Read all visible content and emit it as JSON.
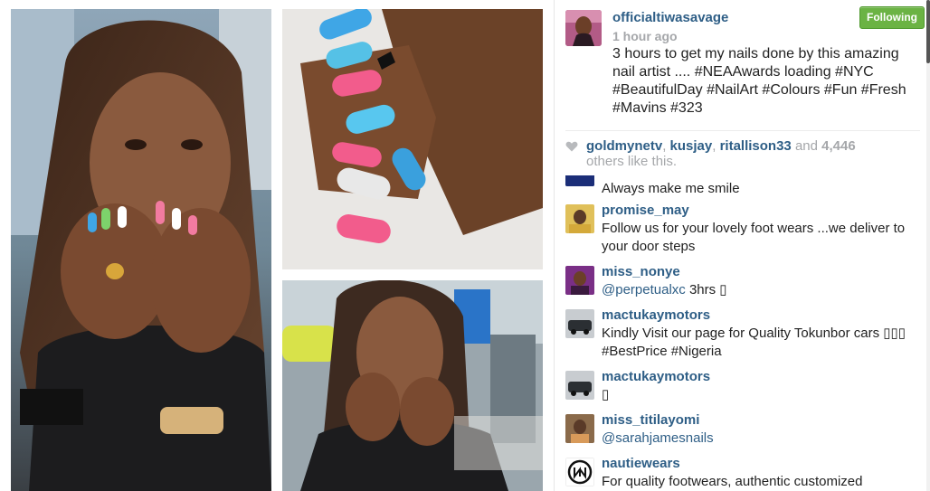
{
  "post": {
    "author": "officialtiwasavage",
    "time": "1 hour ago",
    "follow_label": "Following",
    "caption": "3 hours to get my nails done by this amazing nail artist .... #NEAAwards loading #NYC #BeautifulDay #NailArt #Colours #Fun #Fresh #Mavins #323"
  },
  "likes": {
    "users": [
      "goldmynetv",
      "kusjay",
      "ritallison33"
    ],
    "and_word": "and",
    "count": "4,446",
    "others_text": "others like this."
  },
  "comments": [
    {
      "user": "",
      "text": "Always make me smile",
      "mention": ""
    },
    {
      "user": "promise_may",
      "text": "Follow us for your lovely foot wears ...we deliver to your door steps",
      "mention": ""
    },
    {
      "user": "miss_nonye",
      "mention": "@perpetualxc",
      "text": " 3hrs ▯"
    },
    {
      "user": "mactukaymotors",
      "text": "Kindly Visit our page for Quality Tokunbor cars ▯▯▯ #BestPrice #Nigeria",
      "mention": ""
    },
    {
      "user": "mactukaymotors",
      "text": "▯",
      "mention": ""
    },
    {
      "user": "miss_titilayomi",
      "mention": "@sarahjamesnails",
      "text": ""
    },
    {
      "user": "nautiewears",
      "text": "For quality footwears, authentic customized",
      "mention": ""
    }
  ],
  "icons": {
    "heart": "heart-icon",
    "avatar_style": "photo-thumbnail"
  },
  "colors": {
    "link": "#2e5e86",
    "follow_bg": "#6bb344",
    "muted": "#a5a7aa"
  }
}
